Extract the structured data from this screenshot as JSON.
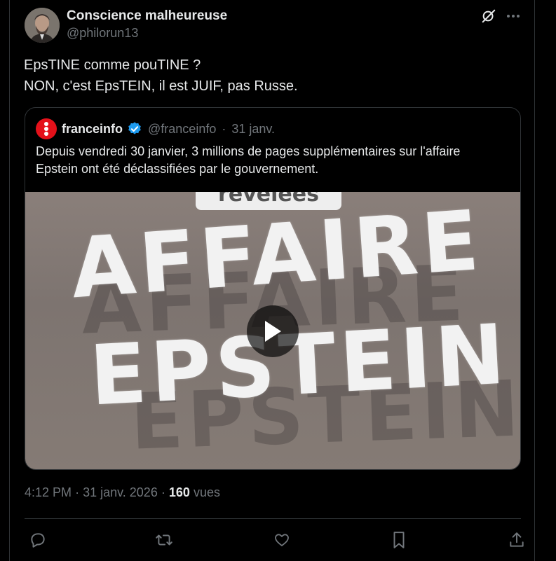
{
  "author": {
    "name": "Conscience malheureuse",
    "handle": "@philorun13"
  },
  "icons": {
    "grok": "grok-icon",
    "more": "more-icon",
    "verified": "verified-badge-icon",
    "play": "play-icon",
    "reply": "reply-icon",
    "retweet": "retweet-icon",
    "like": "like-icon",
    "bookmark": "bookmark-icon",
    "share": "share-icon"
  },
  "tweet": {
    "line1": "EpsTINE comme pouTINE ?",
    "line2": "NON, c'est EpsTEIN, il est JUIF, pas Russe."
  },
  "quote": {
    "name": "franceinfo",
    "handle": "@franceinfo",
    "separator": "·",
    "date": "31 janv.",
    "text": "Depuis vendredi 30 janvier, 3 millions de pages supplémentaires sur l'affaire Epstein ont été déclassifiées par le gouvernement.",
    "media": {
      "tag": "révélées",
      "word1": "AFFAIRE",
      "word2": "EPSTEIN",
      "shadow1": "AFFAIRE",
      "shadow2": "EPSTEIN"
    },
    "brand_color": "#e4111a"
  },
  "meta": {
    "time": "4:12 PM",
    "sep": "·",
    "date": "31 janv. 2026",
    "views_count": "160",
    "views_label": "vues"
  },
  "colors": {
    "background": "#000000",
    "text": "#e7e9ea",
    "muted": "#71767b",
    "border": "#2f3336",
    "verified": "#1d9bf0"
  }
}
